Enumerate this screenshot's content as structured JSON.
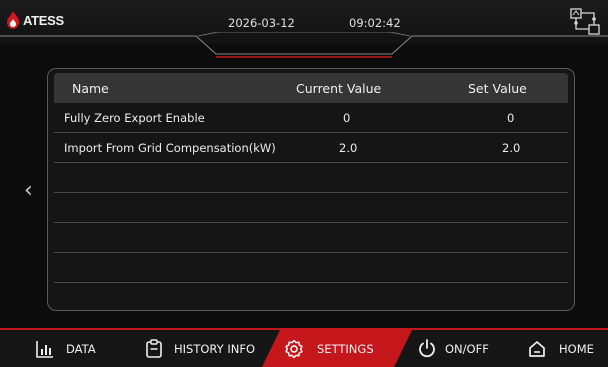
{
  "header": {
    "brand": "ATESS",
    "date": "2026-03-12",
    "time": "09:02:42"
  },
  "table": {
    "columns": [
      "Name",
      "Current Value",
      "Set Value"
    ],
    "rows": [
      {
        "name": "Fully Zero Export Enable",
        "current": "0",
        "set": "0"
      },
      {
        "name": "Import From Grid Compensation(kW)",
        "current": "2.0",
        "set": "2.0"
      },
      {
        "name": "",
        "current": "",
        "set": ""
      },
      {
        "name": "",
        "current": "",
        "set": ""
      },
      {
        "name": "",
        "current": "",
        "set": ""
      },
      {
        "name": "",
        "current": "",
        "set": ""
      }
    ]
  },
  "nav": {
    "data": "DATA",
    "history": "HISTORY INFO",
    "settings": "SETTINGS",
    "onoff": "ON/OFF",
    "home": "HOME"
  },
  "colors": {
    "accent": "#c5161c",
    "background": "#0c0c0c",
    "header_row": "#353535"
  }
}
